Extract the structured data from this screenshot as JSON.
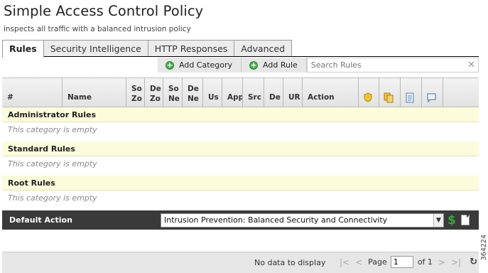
{
  "page": {
    "title": "Simple Access Control Policy",
    "subtitle": "inspects all traffic with a balanced intrusion policy"
  },
  "tabs": [
    {
      "label": "Rules",
      "active": true
    },
    {
      "label": "Security Intelligence",
      "active": false
    },
    {
      "label": "HTTP Responses",
      "active": false
    },
    {
      "label": "Advanced",
      "active": false
    }
  ],
  "toolbar": {
    "add_category_label": "Add Category",
    "add_rule_label": "Add Rule",
    "search_placeholder": "Search Rules"
  },
  "columns": [
    "#",
    "Name",
    "So\nZo",
    "De\nZo",
    "So\nNe",
    "De\nNe",
    "Us",
    "App",
    "Src",
    "De",
    "UR",
    "Action"
  ],
  "column_icons": [
    "shield-icon",
    "copy-icon",
    "log-icon",
    "comment-icon"
  ],
  "categories": [
    {
      "name": "Administrator Rules",
      "empty_text": "This category is empty"
    },
    {
      "name": "Standard Rules",
      "empty_text": "This category is empty"
    },
    {
      "name": "Root Rules",
      "empty_text": "This category is empty"
    }
  ],
  "default_action": {
    "label": "Default Action",
    "value": "Intrusion Prevention: Balanced Security and Connectivity"
  },
  "footer": {
    "no_data": "No data to display",
    "page_label": "Page",
    "page_value": "1",
    "of_label": "of 1"
  },
  "side_number": "364224",
  "colors": {
    "category_bg": "#fcfbdc",
    "default_action_bg": "#3a3a3a",
    "accent_green": "#4aa84a"
  }
}
